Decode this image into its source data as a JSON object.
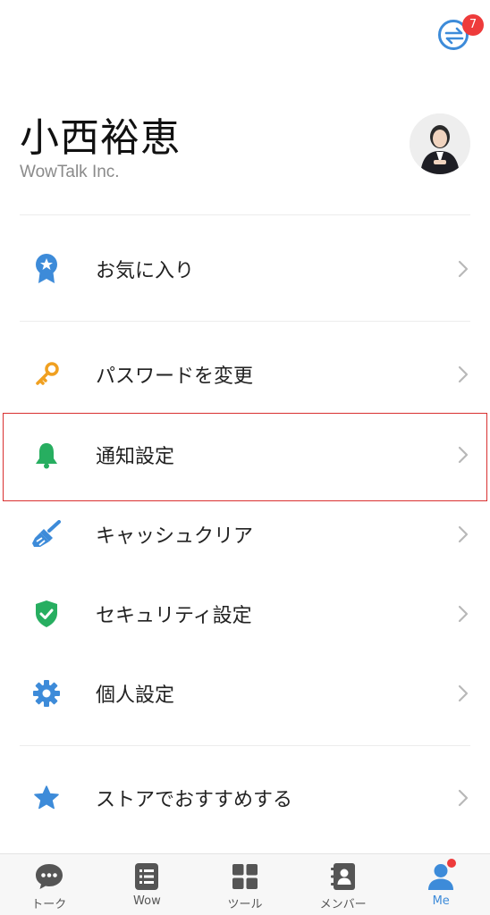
{
  "header": {
    "switch_badge_count": "7",
    "switch_icon": "switch-account-icon"
  },
  "profile": {
    "name": "小西裕恵",
    "company": "WowTalk Inc."
  },
  "menu": [
    {
      "label": "お気に入り",
      "icon": "favorite-ribbon-icon"
    },
    {
      "label": "パスワードを変更",
      "icon": "key-icon"
    },
    {
      "label": "通知設定",
      "icon": "bell-icon"
    },
    {
      "label": "キャッシュクリア",
      "icon": "broom-icon"
    },
    {
      "label": "セキュリティ設定",
      "icon": "shield-check-icon"
    },
    {
      "label": "個人設定",
      "icon": "gear-icon"
    },
    {
      "label": "ストアでおすすめする",
      "icon": "star-icon"
    }
  ],
  "tabs": [
    {
      "label": "トーク",
      "icon": "chat-bubble-icon"
    },
    {
      "label": "Wow",
      "icon": "list-icon"
    },
    {
      "label": "ツール",
      "icon": "grid-icon"
    },
    {
      "label": "メンバー",
      "icon": "contacts-icon"
    },
    {
      "label": "Me",
      "icon": "person-icon"
    }
  ],
  "colors": {
    "accent": "#3d8bd9",
    "badge": "#ee3b3b",
    "highlight": "#d93030",
    "green": "#27ae60",
    "orange": "#f0a020"
  }
}
